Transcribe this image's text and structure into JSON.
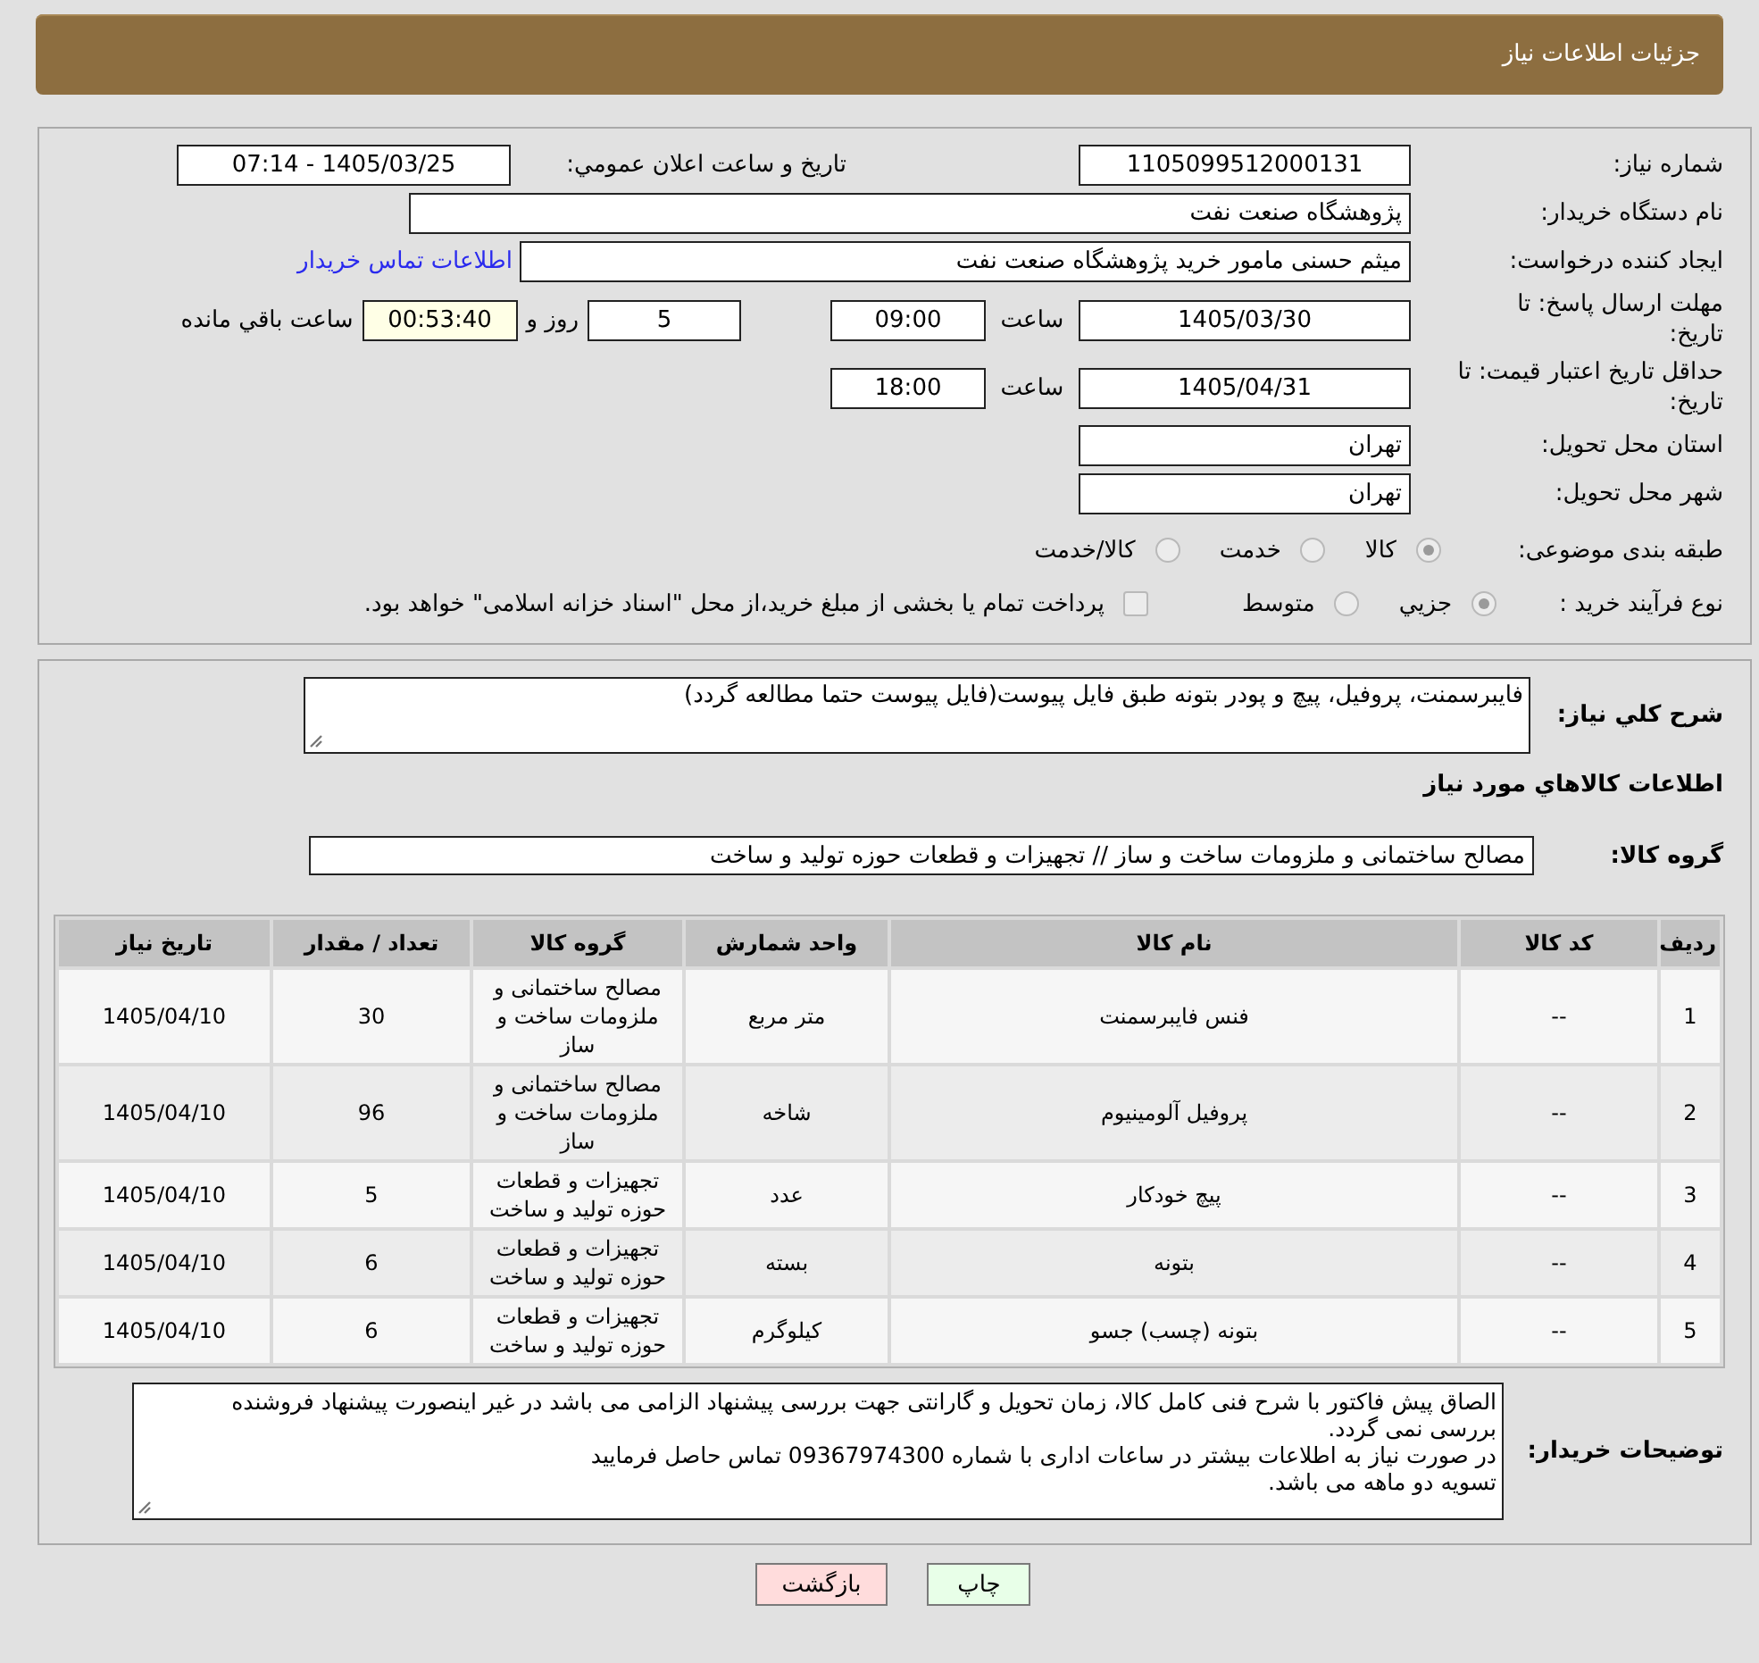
{
  "header": {
    "title": "جزئیات اطلاعات نیاز"
  },
  "details": {
    "need_number": {
      "label": "شماره نیاز:",
      "value": "1105099512000131"
    },
    "announcement": {
      "label": "تاریخ و ساعت اعلان عمومي:",
      "value": "1405/03/25 - 07:14"
    },
    "buyer_org": {
      "label": "نام دستگاه خریدار:",
      "value": "پژوهشگاه صنعت نفت"
    },
    "requester": {
      "label": "ایجاد کننده درخواست:",
      "value": "میثم حسنی مامور خرید پژوهشگاه صنعت نفت",
      "contact_link": "اطلاعات تماس خریدار"
    },
    "reply_deadline": {
      "label": "مهلت ارسال پاسخ: تا تاریخ:",
      "date": "1405/03/30",
      "time_label": "ساعت",
      "time": "09:00",
      "days": "5",
      "days_label": "روز و",
      "remaining": "00:53:40",
      "remaining_label": "ساعت باقي مانده"
    },
    "price_validity": {
      "label": "حداقل تاریخ اعتبار قیمت: تا تاریخ:",
      "date": "1405/04/31",
      "time_label": "ساعت",
      "time": "18:00"
    },
    "province": {
      "label": "استان محل تحویل:",
      "value": "تهران"
    },
    "city": {
      "label": "شهر محل تحویل:",
      "value": "تهران"
    },
    "category": {
      "label": "طبقه بندی موضوعی:",
      "options": [
        {
          "label": "کالا",
          "selected": true
        },
        {
          "label": "خدمت",
          "selected": false
        },
        {
          "label": "کالا/خدمت",
          "selected": false
        }
      ]
    },
    "purchase_process": {
      "label": "نوع فرآیند خرید :",
      "options": [
        {
          "label": "جزيي",
          "selected": true
        },
        {
          "label": "متوسط",
          "selected": false
        }
      ],
      "treasury_bonds": {
        "label": "پرداخت تمام یا بخشی از مبلغ خرید،از محل \"اسناد خزانه اسلامی\" خواهد بود.",
        "checked": false
      }
    }
  },
  "items": {
    "description": {
      "label": "شرح کلي نیاز:",
      "value": "فایبرسمنت، پروفیل، پیچ و پودر بتونه طبق فایل پیوست(فایل پیوست حتما مطالعه گردد)"
    },
    "heading": "اطلاعات کالاهاي مورد نیاز",
    "group": {
      "label": "گروه کالا:",
      "value": "مصالح ساختمانی و ملزومات ساخت و ساز // تجهیزات و قطعات حوزه تولید و ساخت"
    },
    "table": {
      "columns": [
        "ردیف",
        "کد کالا",
        "نام کالا",
        "واحد شمارش",
        "گروه کالا",
        "تعداد / مقدار",
        "تاریخ نیاز"
      ],
      "rows": [
        [
          "1",
          "--",
          "فنس فایبرسمنت",
          "متر مربع",
          "مصالح ساختمانی و ملزومات ساخت و ساز",
          "30",
          "1405/04/10"
        ],
        [
          "2",
          "--",
          "پروفیل آلومینیوم",
          "شاخه",
          "مصالح ساختمانی و ملزومات ساخت و ساز",
          "96",
          "1405/04/10"
        ],
        [
          "3",
          "--",
          "پیچ خودکار",
          "عدد",
          "تجهیزات و قطعات حوزه تولید و ساخت",
          "5",
          "1405/04/10"
        ],
        [
          "4",
          "--",
          "بتونه",
          "بسته",
          "تجهیزات و قطعات حوزه تولید و ساخت",
          "6",
          "1405/04/10"
        ],
        [
          "5",
          "--",
          "بتونه (چسب) جسو",
          "کیلوگرم",
          "تجهیزات و قطعات حوزه تولید و ساخت",
          "6",
          "1405/04/10"
        ]
      ]
    },
    "buyer_notes": {
      "label": "توضیحات خریدار:",
      "value": "الصاق پیش فاکتور با شرح فنی کامل کالا، زمان تحویل و گارانتی جهت بررسی پیشنهاد الزامی می باشد در غیر اینصورت پیشنهاد فروشنده بررسی نمی گردد.\nدر صورت نیاز به اطلاعات بیشتر در ساعات اداری با شماره 09367974300 تماس حاصل فرمایید\nتسویه دو ماهه می باشد."
    }
  },
  "buttons": [
    {
      "label": "چاپ",
      "kind": "print"
    },
    {
      "label": "بازگشت",
      "kind": "back"
    }
  ]
}
